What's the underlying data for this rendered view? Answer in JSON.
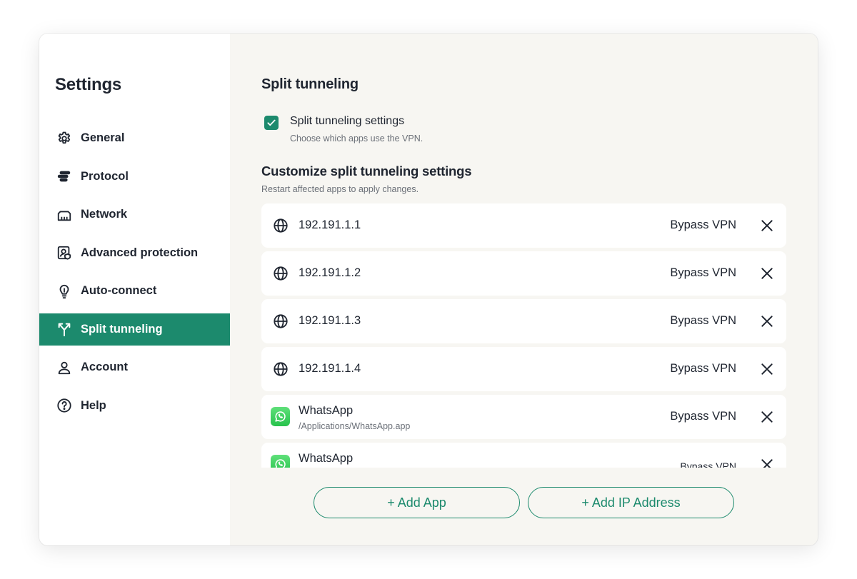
{
  "colors": {
    "accent": "#1c8a6d",
    "sidebar_bg": "#ffffff",
    "main_bg": "#f7f6f2",
    "text": "#1f2530",
    "muted": "#6b7078"
  },
  "sidebar": {
    "title": "Settings",
    "items": [
      {
        "label": "General",
        "icon": "gear-icon",
        "active": false
      },
      {
        "label": "Protocol",
        "icon": "protocol-icon",
        "active": false
      },
      {
        "label": "Network",
        "icon": "network-icon",
        "active": false
      },
      {
        "label": "Advanced protection",
        "icon": "advanced-protection-icon",
        "active": false
      },
      {
        "label": "Auto-connect",
        "icon": "lightbulb-icon",
        "active": false
      },
      {
        "label": "Split tunneling",
        "icon": "split-icon",
        "active": true
      },
      {
        "label": "Account",
        "icon": "user-icon",
        "active": false
      },
      {
        "label": "Help",
        "icon": "help-icon",
        "active": false
      }
    ]
  },
  "main": {
    "title": "Split tunneling",
    "toggle": {
      "label": "Split tunneling settings",
      "description": "Choose which apps use the VPN.",
      "checked": true
    },
    "customize": {
      "title": "Customize split tunneling settings",
      "description": "Restart affected apps to apply changes."
    },
    "entries": [
      {
        "type": "ip",
        "icon": "globe-icon",
        "name": "192.191.1.1",
        "mode": "Bypass VPN"
      },
      {
        "type": "ip",
        "icon": "globe-icon",
        "name": "192.191.1.2",
        "mode": "Bypass VPN"
      },
      {
        "type": "ip",
        "icon": "globe-icon",
        "name": "192.191.1.3",
        "mode": "Bypass VPN"
      },
      {
        "type": "ip",
        "icon": "globe-icon",
        "name": "192.191.1.4",
        "mode": "Bypass VPN"
      },
      {
        "type": "app",
        "icon": "whatsapp-icon",
        "name": "WhatsApp",
        "path": "/Applications/WhatsApp.app",
        "mode": "Bypass VPN"
      },
      {
        "type": "app",
        "icon": "whatsapp-icon",
        "name": "WhatsApp",
        "path": "",
        "mode": "Bypass VPN"
      }
    ],
    "buttons": {
      "add_app": "+ Add App",
      "add_ip": "+ Add IP Address"
    }
  }
}
